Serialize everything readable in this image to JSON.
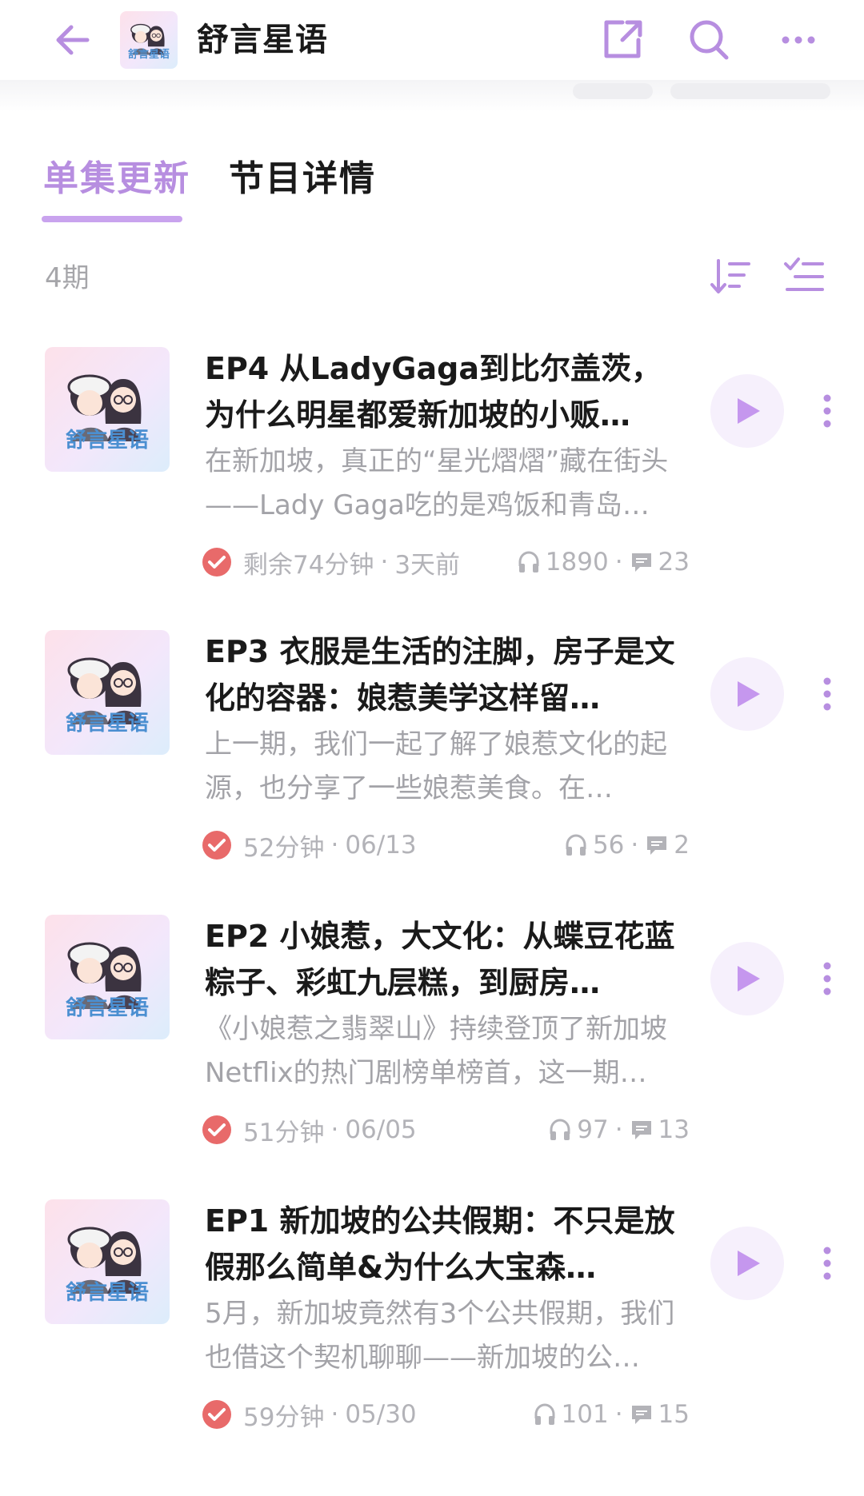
{
  "header": {
    "title": "舒言星语",
    "cover_text": "舒言星语"
  },
  "tabs": [
    {
      "label": "单集更新",
      "active": true
    },
    {
      "label": "节目详情",
      "active": false
    }
  ],
  "list": {
    "count_label": "4期"
  },
  "episodes": [
    {
      "title": "EP4 从LadyGaga到比尔盖茨，为什么明星都爱新加坡的小贩…",
      "description": "在新加坡，真正的“星光熠熠”藏在街头——Lady Gaga吃的是鸡饭和青岛…",
      "duration": "剩余74分钟",
      "date": "3天前",
      "plays": "1890",
      "comments": "23",
      "cover_text": "舒言星语"
    },
    {
      "title": "EP3 衣服是生活的注脚，房子是文化的容器：娘惹美学这样留…",
      "description": "上一期，我们一起了解了娘惹文化的起源，也分享了一些娘惹美食。在…",
      "duration": "52分钟",
      "date": "06/13",
      "plays": "56",
      "comments": "2",
      "cover_text": "舒言星语"
    },
    {
      "title": "EP2 小娘惹，大文化：从蝶豆花蓝粽子、彩虹九层糕，到厨房…",
      "description": "《小娘惹之翡翠山》持续登顶了新加坡Netflix的热门剧榜单榜首，这一期…",
      "duration": "51分钟",
      "date": "06/05",
      "plays": "97",
      "comments": "13",
      "cover_text": "舒言星语"
    },
    {
      "title": "EP1 新加坡的公共假期：不只是放假那么简单&为什么大宝森…",
      "description": "5月，新加坡竟然有3个公共假期，我们也借这个契机聊聊——新加坡的公…",
      "duration": "59分钟",
      "date": "05/30",
      "plays": "101",
      "comments": "15",
      "cover_text": "舒言星语"
    }
  ],
  "icons": {
    "back": "arrow-left-icon",
    "share": "share-icon",
    "search": "search-icon",
    "more": "more-horizontal-icon",
    "sort": "sort-icon",
    "filter": "filter-list-icon",
    "check": "check-circle-icon",
    "headphones": "headphones-icon",
    "comment": "comment-icon",
    "play": "play-icon",
    "item_more": "more-vertical-icon"
  },
  "colors": {
    "accent": "#b78ee0",
    "accent_underline": "#c9a3ee",
    "check_red": "#e86a6a",
    "play_bg": "#f6f0fc",
    "muted_text": "#a3a3a8"
  }
}
